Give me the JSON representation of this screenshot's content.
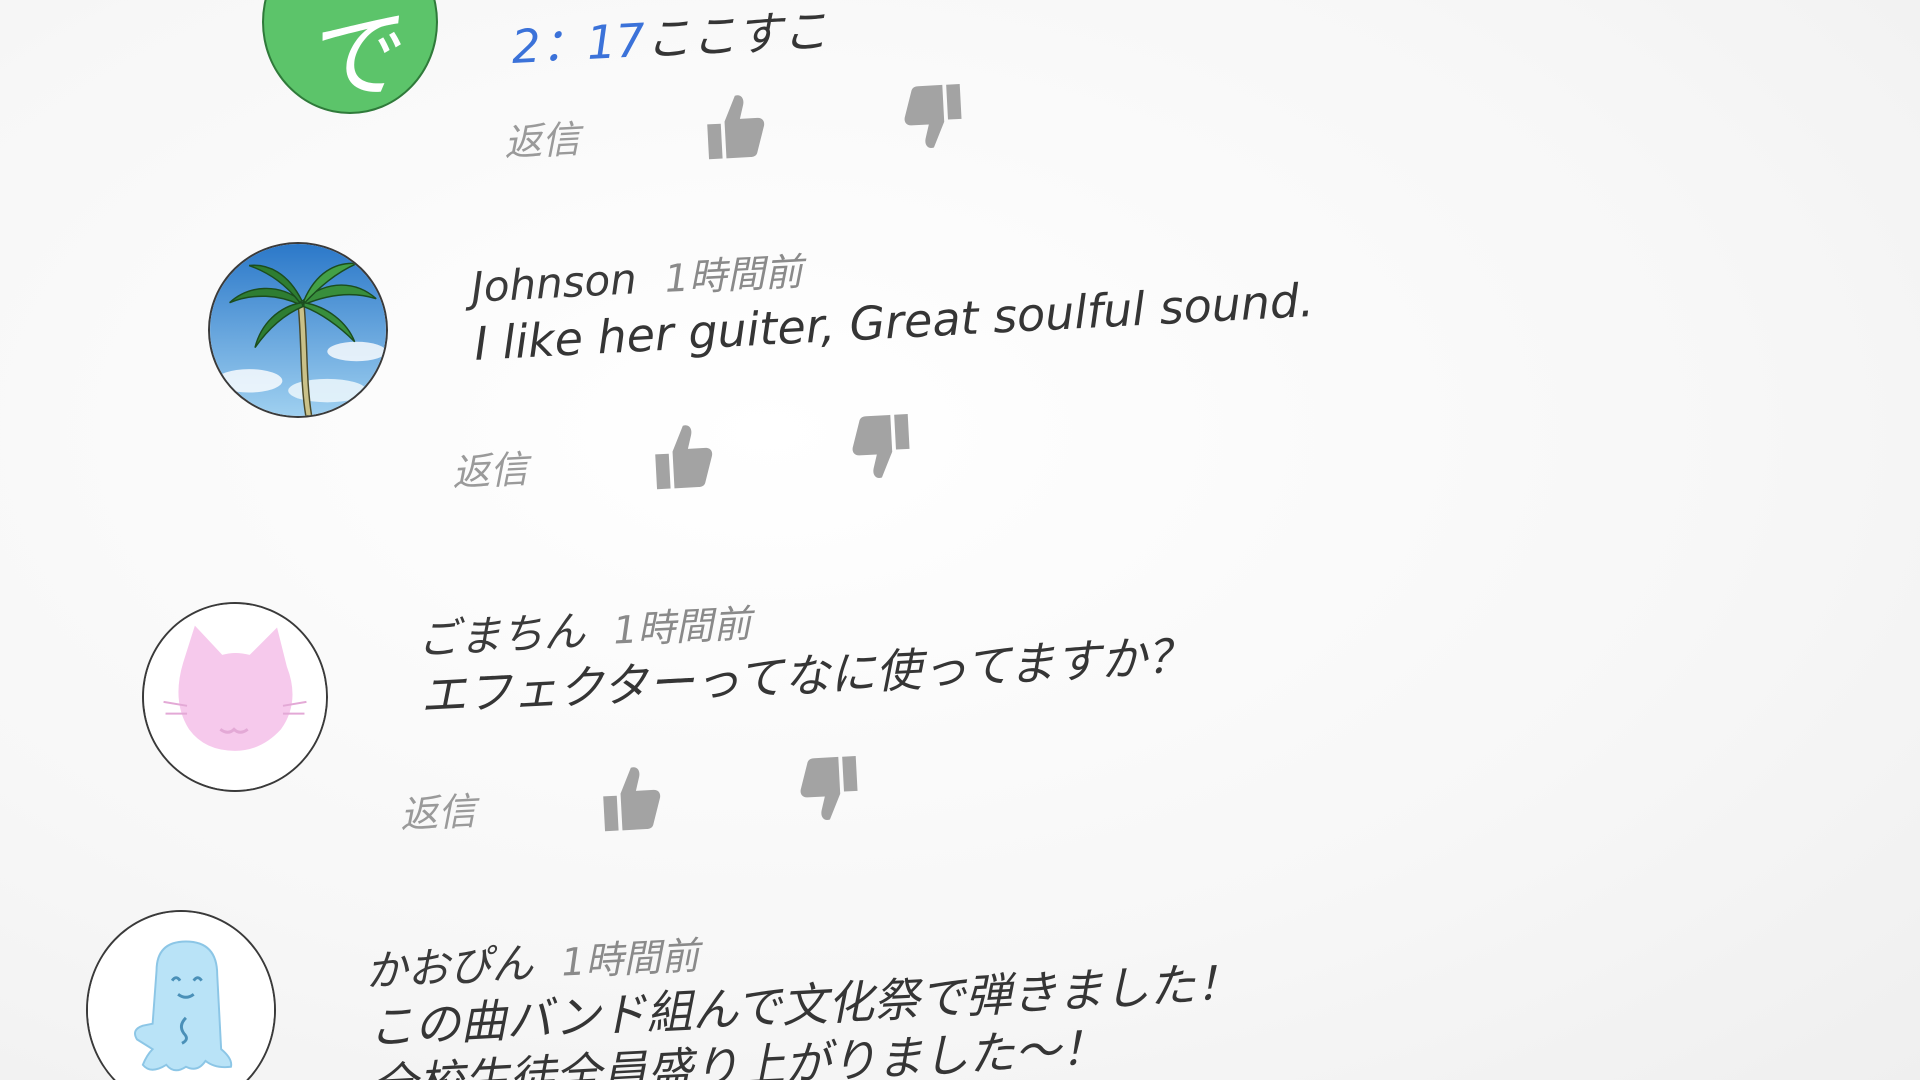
{
  "comments": [
    {
      "avatar_glyph": "で",
      "author": "",
      "time": "",
      "timestamp_link": "2：17",
      "message": "ここすこ",
      "reply_label": "返信",
      "avatar_icon": "green-circle-de-avatar",
      "avatar_color": "#5cc46a"
    },
    {
      "author": "Johnson",
      "time": "1時間前",
      "message": "I like her guiter, Great soulful sound.",
      "reply_label": "返信",
      "avatar_icon": "palm-tree-avatar"
    },
    {
      "author": "ごまちん",
      "time": "1時間前",
      "message": "エフェクターってなに使ってますか？",
      "reply_label": "返信",
      "avatar_icon": "pink-cat-avatar"
    },
    {
      "author": "かおぴん",
      "time": "1時間前",
      "message_lines": [
        "この曲バンド組んで文化祭で弾きました！",
        "全校生徒全員盛り上がりました〜！"
      ],
      "reply_label": "",
      "avatar_icon": "blue-ghost-avatar"
    }
  ],
  "icons": {
    "like": "thumbs-up-icon",
    "dislike": "thumbs-down-icon"
  },
  "colors": {
    "link_blue": "#3b72d9",
    "icon_gray": "#9a9a9a",
    "text_dark": "#3a3a3a"
  }
}
